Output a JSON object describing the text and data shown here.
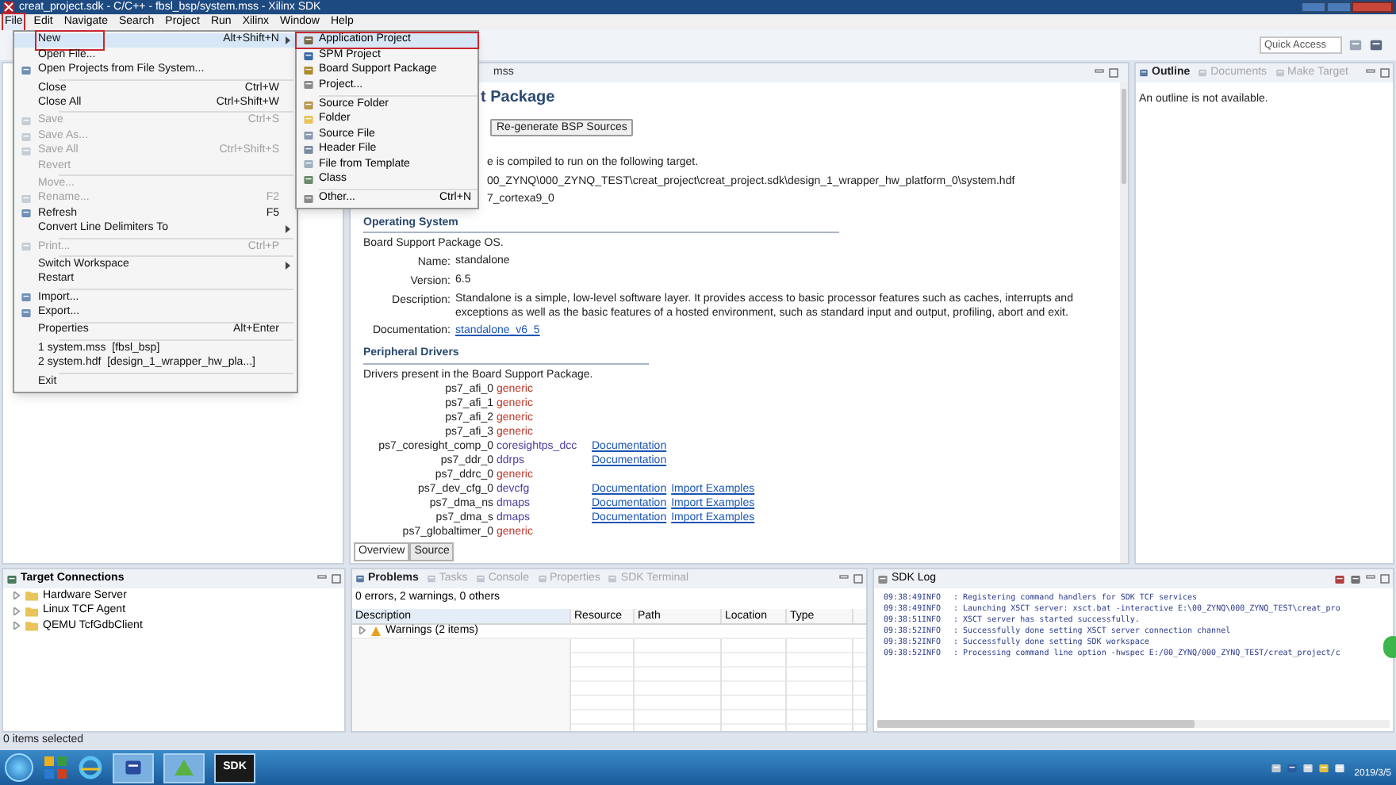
{
  "window": {
    "title": "creat_project.sdk - C/C++ - fbsl_bsp/system.mss - Xilinx SDK"
  },
  "menu_bar": [
    {
      "label": "File",
      "selected": true
    },
    {
      "label": "Edit",
      "selected": false
    },
    {
      "label": "Navigate",
      "selected": false
    },
    {
      "label": "Search",
      "selected": false
    },
    {
      "label": "Project",
      "selected": false
    },
    {
      "label": "Run",
      "selected": false
    },
    {
      "label": "Xilinx",
      "selected": false
    },
    {
      "label": "Window",
      "selected": false
    },
    {
      "label": "Help",
      "selected": false
    }
  ],
  "quick_access": {
    "placeholder": "Quick Access"
  },
  "file_menu": {
    "items": [
      {
        "kind": "item",
        "label": "New",
        "shortcut": "Alt+Shift+N",
        "submenu": true,
        "icon": false,
        "disabled": false,
        "marked": true
      },
      {
        "kind": "item",
        "label": "Open File...",
        "icon": false,
        "submenu": false,
        "disabled": false,
        "marked": false
      },
      {
        "kind": "item",
        "label": "Open Projects from File System...",
        "icon": true,
        "submenu": false,
        "disabled": false,
        "marked": false
      },
      {
        "kind": "separator"
      },
      {
        "kind": "item",
        "label": "Close",
        "shortcut": "Ctrl+W",
        "icon": false,
        "submenu": false,
        "disabled": false,
        "marked": false
      },
      {
        "kind": "item",
        "label": "Close All",
        "shortcut": "Ctrl+Shift+W",
        "icon": false,
        "submenu": false,
        "disabled": false,
        "marked": false
      },
      {
        "kind": "separator"
      },
      {
        "kind": "item",
        "label": "Save",
        "shortcut": "Ctrl+S",
        "icon": true,
        "submenu": false,
        "disabled": true,
        "marked": false
      },
      {
        "kind": "item",
        "label": "Save As...",
        "icon": true,
        "submenu": false,
        "disabled": true,
        "marked": false
      },
      {
        "kind": "item",
        "label": "Save All",
        "shortcut": "Ctrl+Shift+S",
        "icon": true,
        "submenu": false,
        "disabled": true,
        "marked": false
      },
      {
        "kind": "item",
        "label": "Revert",
        "icon": false,
        "submenu": false,
        "disabled": true,
        "marked": false
      },
      {
        "kind": "separator"
      },
      {
        "kind": "item",
        "label": "Move...",
        "icon": false,
        "submenu": false,
        "disabled": true,
        "marked": false
      },
      {
        "kind": "item",
        "label": "Rename...",
        "shortcut": "F2",
        "icon": true,
        "submenu": false,
        "disabled": true,
        "marked": false
      },
      {
        "kind": "item",
        "label": "Refresh",
        "shortcut": "F5",
        "icon": true,
        "submenu": false,
        "disabled": false,
        "marked": false
      },
      {
        "kind": "item",
        "label": "Convert Line Delimiters To",
        "icon": false,
        "submenu": true,
        "disabled": false,
        "marked": false
      },
      {
        "kind": "separator"
      },
      {
        "kind": "item",
        "label": "Print...",
        "shortcut": "Ctrl+P",
        "icon": true,
        "submenu": false,
        "disabled": true,
        "marked": false
      },
      {
        "kind": "separator"
      },
      {
        "kind": "item",
        "label": "Switch Workspace",
        "icon": false,
        "submenu": true,
        "disabled": false,
        "marked": false
      },
      {
        "kind": "item",
        "label": "Restart",
        "icon": false,
        "submenu": false,
        "disabled": false,
        "marked": false
      },
      {
        "kind": "separator"
      },
      {
        "kind": "item",
        "label": "Import...",
        "icon": true,
        "submenu": false,
        "disabled": false,
        "marked": false
      },
      {
        "kind": "item",
        "label": "Export...",
        "icon": true,
        "submenu": false,
        "disabled": false,
        "marked": false
      },
      {
        "kind": "separator"
      },
      {
        "kind": "item",
        "label": "Properties",
        "shortcut": "Alt+Enter",
        "icon": false,
        "submenu": false,
        "disabled": false,
        "marked": false
      },
      {
        "kind": "separator"
      },
      {
        "kind": "item",
        "label": "1 system.mss  [fbsl_bsp]",
        "icon": false,
        "submenu": false,
        "disabled": false,
        "marked": false
      },
      {
        "kind": "item",
        "label": "2 system.hdf  [design_1_wrapper_hw_pla...]",
        "icon": false,
        "submenu": false,
        "disabled": false,
        "marked": false
      },
      {
        "kind": "separator"
      },
      {
        "kind": "item",
        "label": "Exit",
        "icon": false,
        "submenu": false,
        "disabled": false,
        "marked": false
      }
    ]
  },
  "new_submenu": {
    "items": [
      {
        "kind": "item",
        "label": "Application Project",
        "marked": true
      },
      {
        "kind": "item",
        "label": "SPM Project",
        "marked": false
      },
      {
        "kind": "item",
        "label": "Board Support Package",
        "marked": false
      },
      {
        "kind": "item",
        "label": "Project...",
        "marked": false
      },
      {
        "kind": "separator"
      },
      {
        "kind": "item",
        "label": "Source Folder",
        "marked": false
      },
      {
        "kind": "item",
        "label": "Folder",
        "marked": false
      },
      {
        "kind": "item",
        "label": "Source File",
        "marked": false
      },
      {
        "kind": "item",
        "label": "Header File",
        "marked": false
      },
      {
        "kind": "item",
        "label": "File from Template",
        "marked": false
      },
      {
        "kind": "item",
        "label": "Class",
        "marked": false
      },
      {
        "kind": "separator"
      },
      {
        "kind": "item",
        "label": "Other...",
        "shortcut": "Ctrl+N",
        "marked": false
      }
    ]
  },
  "editor": {
    "tab_label": "mss",
    "title": "t Package",
    "regen_button": "Re-generate BSP Sources",
    "target_lines": [
      "e is compiled to run on the following target.",
      "00_ZYNQ\\000_ZYNQ_TEST\\creat_project\\creat_project.sdk\\design_1_wrapper_hw_platform_0\\system.hdf",
      "7_cortexa9_0"
    ],
    "os_heading": "Operating System",
    "os_intro": "Board Support Package OS.",
    "os_fields": [
      {
        "label": "Name:",
        "value": "standalone",
        "link": false
      },
      {
        "label": "Version:",
        "value": "6.5",
        "link": false
      },
      {
        "label": "Description:",
        "value": "Standalone is a simple, low-level software layer. It provides access to basic processor features such as caches, interrupts and exceptions as well as the basic features of a hosted environment, such as standard input and output, profiling, abort and exit.",
        "link": false
      },
      {
        "label": "Documentation:",
        "value": "standalone_v6_5",
        "link": true
      }
    ],
    "drivers_heading": "Peripheral Drivers",
    "drivers_intro": "Drivers present in the Board Support Package.",
    "drivers": [
      {
        "name": "ps7_afi_0",
        "driver": "generic",
        "color": "#c0392b"
      },
      {
        "name": "ps7_afi_1",
        "driver": "generic",
        "color": "#c0392b"
      },
      {
        "name": "ps7_afi_2",
        "driver": "generic",
        "color": "#c0392b"
      },
      {
        "name": "ps7_afi_3",
        "driver": "generic",
        "color": "#c0392b"
      },
      {
        "name": "ps7_coresight_comp_0",
        "driver": "coresightps_dcc",
        "color": "#4b3fa0",
        "links": [
          "Documentation"
        ]
      },
      {
        "name": "ps7_ddr_0",
        "driver": "ddrps",
        "color": "#4b3fa0",
        "links": [
          "Documentation"
        ]
      },
      {
        "name": "ps7_ddrc_0",
        "driver": "generic",
        "color": "#c0392b"
      },
      {
        "name": "ps7_dev_cfg_0",
        "driver": "devcfg",
        "color": "#4b3fa0",
        "links": [
          "Documentation",
          "Import Examples"
        ]
      },
      {
        "name": "ps7_dma_ns",
        "driver": "dmaps",
        "color": "#4b3fa0",
        "links": [
          "Documentation",
          "Import Examples"
        ]
      },
      {
        "name": "ps7_dma_s",
        "driver": "dmaps",
        "color": "#4b3fa0",
        "links": [
          "Documentation",
          "Import Examples"
        ]
      },
      {
        "name": "ps7_globaltimer_0",
        "driver": "generic",
        "color": "#c0392b"
      }
    ],
    "bottom_tabs": [
      {
        "label": "Overview",
        "selected": true
      },
      {
        "label": "Source",
        "selected": false
      }
    ]
  },
  "outline": {
    "tabs": [
      {
        "label": "Outline",
        "selected": true
      },
      {
        "label": "Documents",
        "selected": false
      },
      {
        "label": "Make Target",
        "selected": false
      }
    ],
    "message": "An outline is not available."
  },
  "target_connections": {
    "title": "Target Connections",
    "items": [
      "Hardware Server",
      "Linux TCF Agent",
      "QEMU TcfGdbClient"
    ]
  },
  "problems": {
    "tabs": [
      {
        "label": "Problems",
        "selected": true
      },
      {
        "label": "Tasks",
        "selected": false
      },
      {
        "label": "Console",
        "selected": false
      },
      {
        "label": "Properties",
        "selected": false
      },
      {
        "label": "SDK Terminal",
        "selected": false
      }
    ],
    "summary": "0 errors, 2 warnings, 0 others",
    "columns": [
      "Description",
      "Resource",
      "Path",
      "Location",
      "Type"
    ],
    "rows": [
      {
        "label": "Warnings (2 items)",
        "expanded": false
      }
    ]
  },
  "sdk_log": {
    "title": "SDK Log",
    "lines": [
      {
        "time": "09:38:49",
        "level": "INFO",
        "message": ": Registering command handlers for SDK TCF services"
      },
      {
        "time": "09:38:49",
        "level": "INFO",
        "message": ": Launching XSCT server: xsct.bat -interactive E:\\00_ZYNQ\\000_ZYNQ_TEST\\creat_pro"
      },
      {
        "time": "09:38:51",
        "level": "INFO",
        "message": ": XSCT server has started successfully."
      },
      {
        "time": "09:38:52",
        "level": "INFO",
        "message": ": Successfully done setting XSCT server connection channel"
      },
      {
        "time": "09:38:52",
        "level": "INFO",
        "message": ": Successfully done setting SDK workspace"
      },
      {
        "time": "09:38:52",
        "level": "INFO",
        "message": ": Processing command line option -hwspec E:/00_ZYNQ/000_ZYNQ_TEST/creat_project/c"
      }
    ]
  },
  "status_bar": {
    "text": "0 items selected"
  },
  "taskbar": {
    "active_app_label": "SDK",
    "date": "2019/3/5"
  }
}
